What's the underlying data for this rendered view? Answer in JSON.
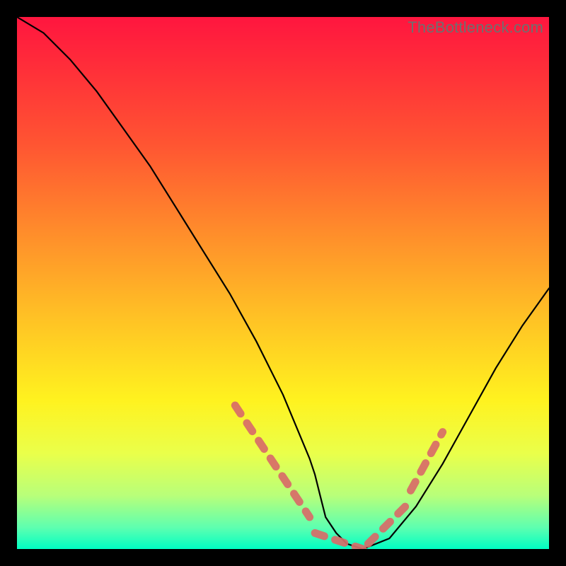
{
  "watermark": "TheBottleneck.com",
  "chart_data": {
    "type": "line",
    "title": "",
    "xlabel": "",
    "ylabel": "",
    "xlim": [
      0,
      100
    ],
    "ylim": [
      0,
      100
    ],
    "series": [
      {
        "name": "curve",
        "x": [
          0,
          5,
          10,
          15,
          20,
          25,
          30,
          35,
          40,
          45,
          50,
          55,
          56,
          57,
          58,
          60,
          62,
          65,
          70,
          75,
          80,
          85,
          90,
          95,
          100
        ],
        "values": [
          100,
          97,
          92,
          86,
          79,
          72,
          64,
          56,
          48,
          39,
          29,
          17,
          14,
          10,
          6,
          3,
          1,
          0,
          2,
          8,
          16,
          25,
          34,
          42,
          49
        ]
      }
    ],
    "annotations": {
      "dashed_segments": [
        {
          "x": [
            41,
            55
          ],
          "values": [
            27,
            6
          ]
        },
        {
          "x": [
            56,
            65
          ],
          "values": [
            3,
            0
          ]
        },
        {
          "x": [
            66,
            73
          ],
          "values": [
            1,
            8
          ]
        },
        {
          "x": [
            74,
            80
          ],
          "values": [
            11,
            22
          ]
        }
      ]
    }
  },
  "colors": {
    "curve": "#000000",
    "dash": "#d86b68",
    "background_top": "#ff163f",
    "background_bottom": "#00ffc3"
  }
}
